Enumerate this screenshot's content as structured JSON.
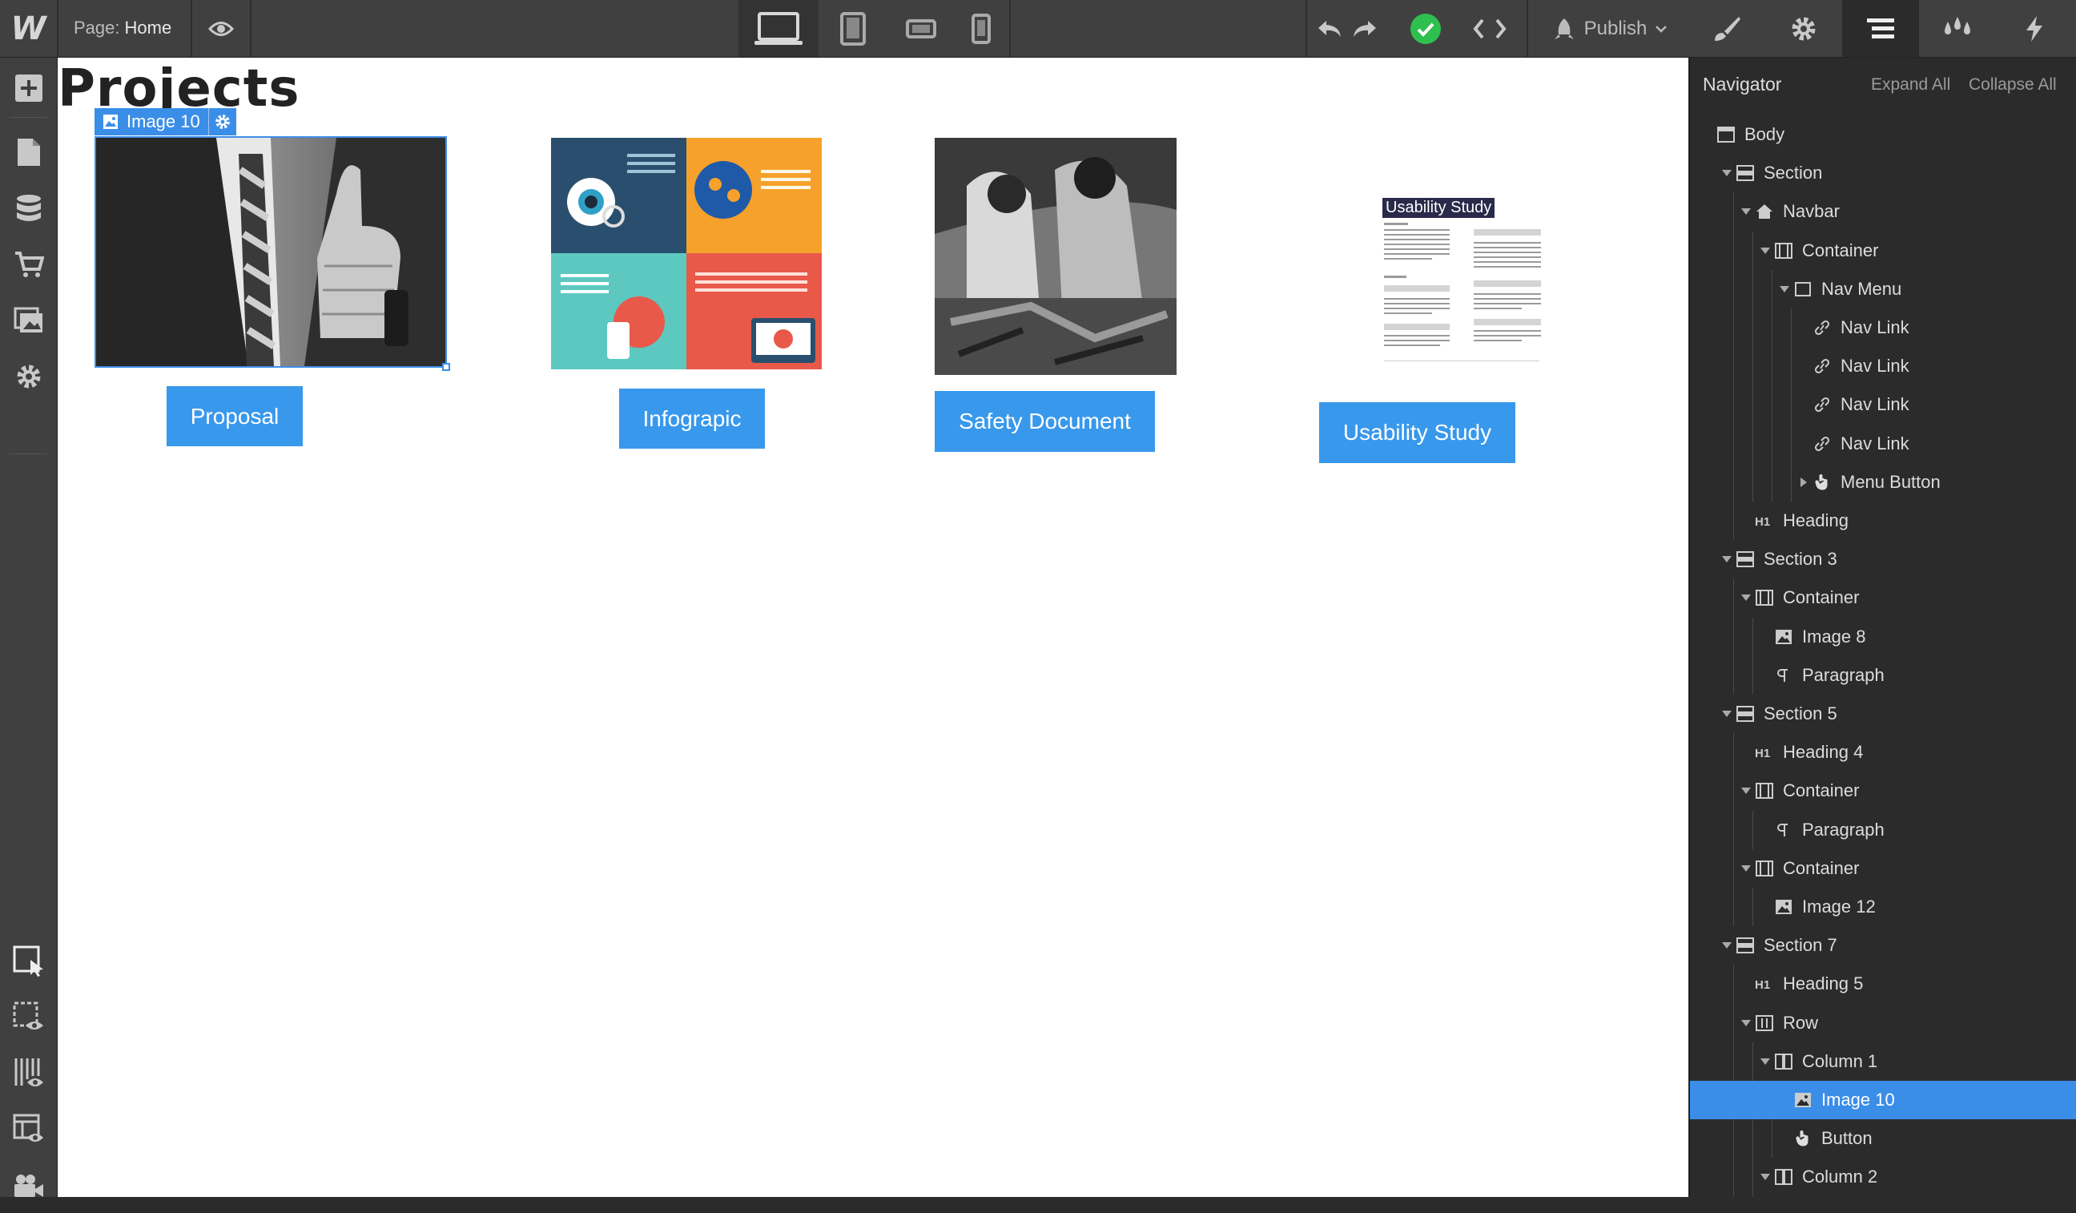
{
  "topbar": {
    "logo": "W",
    "page_prefix": "Page:",
    "page_name": "Home",
    "publish_label": "Publish"
  },
  "canvas": {
    "heading": "Projects",
    "selected_label": "Image 10",
    "projects": [
      {
        "button": "Proposal"
      },
      {
        "button": "Infograpic"
      },
      {
        "button": "Safety Document"
      },
      {
        "button": "Usability Study"
      }
    ],
    "usability_doc_title": "Usability Study"
  },
  "navigator": {
    "title": "Navigator",
    "expand_all": "Expand All",
    "collapse_all": "Collapse All",
    "nodes": [
      {
        "label": "Body",
        "icon": "body-icon"
      },
      {
        "label": "Section",
        "icon": "section-icon"
      },
      {
        "label": "Navbar",
        "icon": "navbar-icon"
      },
      {
        "label": "Container",
        "icon": "container-icon"
      },
      {
        "label": "Nav Menu",
        "icon": "navmenu-icon"
      },
      {
        "label": "Nav Link",
        "icon": "link-icon"
      },
      {
        "label": "Nav Link",
        "icon": "link-icon"
      },
      {
        "label": "Nav Link",
        "icon": "link-icon"
      },
      {
        "label": "Nav Link",
        "icon": "link-icon"
      },
      {
        "label": "Menu Button",
        "icon": "hand-icon"
      },
      {
        "label": "Heading",
        "icon": "h1-icon"
      },
      {
        "label": "Section 3",
        "icon": "section-icon"
      },
      {
        "label": "Container",
        "icon": "container-icon"
      },
      {
        "label": "Image 8",
        "icon": "image-icon"
      },
      {
        "label": "Paragraph",
        "icon": "paragraph-icon"
      },
      {
        "label": "Section 5",
        "icon": "section-icon"
      },
      {
        "label": "Heading 4",
        "icon": "h1-icon"
      },
      {
        "label": "Container",
        "icon": "container-icon"
      },
      {
        "label": "Paragraph",
        "icon": "paragraph-icon"
      },
      {
        "label": "Container",
        "icon": "container-icon"
      },
      {
        "label": "Image 12",
        "icon": "image-icon"
      },
      {
        "label": "Section 7",
        "icon": "section-icon"
      },
      {
        "label": "Heading 5",
        "icon": "h1-icon"
      },
      {
        "label": "Row",
        "icon": "row-icon"
      },
      {
        "label": "Column 1",
        "icon": "column-icon"
      },
      {
        "label": "Image 10",
        "icon": "image-icon",
        "selected": true
      },
      {
        "label": "Button",
        "icon": "hand-icon"
      },
      {
        "label": "Column 2",
        "icon": "column-icon"
      }
    ]
  },
  "colors": {
    "accent": "#3b8ee8",
    "button": "#3898ec",
    "success": "#2fbf4f"
  }
}
